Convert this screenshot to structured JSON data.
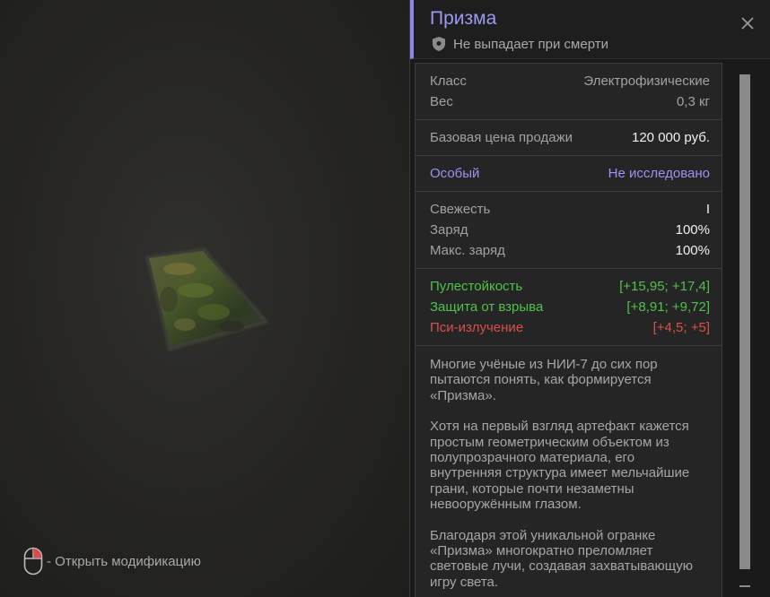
{
  "hint": {
    "text": "- Открыть модификацию",
    "icon": "mouse-icon"
  },
  "item": {
    "title": "Призма",
    "subtitle": "Не выпадает при смерти",
    "subtitle_icon": "shield-icon",
    "accent_color": "#9d98f2"
  },
  "stats": {
    "class": {
      "label": "Класс",
      "value": "Электрофизические"
    },
    "weight": {
      "label": "Вес",
      "value": "0,3 кг"
    },
    "price": {
      "label": "Базовая цена продажи",
      "value": "120 000 руб."
    },
    "special": {
      "label": "Особый",
      "value": "Не исследовано"
    },
    "freshness": {
      "label": "Свежесть",
      "value": "I"
    },
    "charge": {
      "label": "Заряд",
      "value": "100%"
    },
    "max_charge": {
      "label": "Макс. заряд",
      "value": "100%"
    },
    "bulletproof": {
      "label": "Пулестойкость",
      "value": "[+15,95; +17,4]"
    },
    "blast": {
      "label": "Защита от взрыва",
      "value": "[+8,91; +9,72]"
    },
    "psi": {
      "label": "Пси-излучение",
      "value": "[+4,5; +5]"
    }
  },
  "description": [
    "Многие учёные из НИИ-7 до сих пор пытаются понять, как формируется «Призма».",
    "Хотя на первый взгляд артефакт кажется простым геометрическим объектом из полупрозрачного материала, его внутренняя структура имеет мельчайшие грани, которые почти незаметны невооружённым глазом.",
    "Благодаря этой уникальной огранке «Призма» многократно преломляет световые лучи, создавая захватывающую игру света."
  ],
  "colors": {
    "positive": "#4fc24a",
    "negative": "#d8504a",
    "special": "#9a95f0"
  }
}
